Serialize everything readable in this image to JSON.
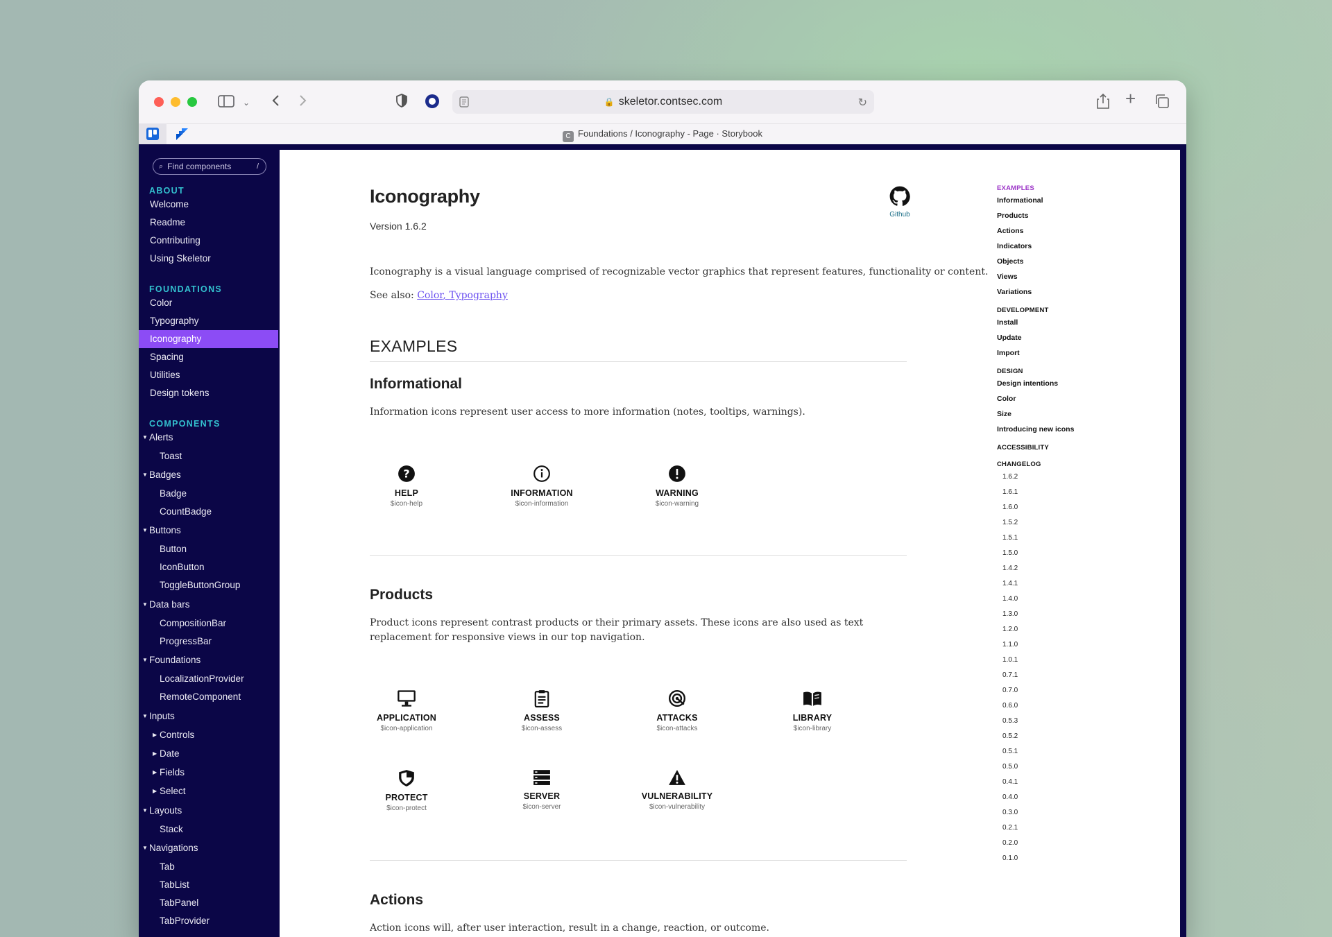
{
  "browser": {
    "url": "skeletor.contsec.com",
    "tab_title": "Foundations / Iconography - Page · Storybook",
    "favicon": "C"
  },
  "sidebar": {
    "search_placeholder": "Find components",
    "search_shortcut": "/",
    "sections": {
      "about": "ABOUT",
      "foundations": "FOUNDATIONS",
      "components": "COMPONENTS"
    },
    "about": [
      "Welcome",
      "Readme",
      "Contributing",
      "Using Skeletor"
    ],
    "foundations": [
      "Color",
      "Typography",
      "Iconography",
      "Spacing",
      "Utilities",
      "Design tokens"
    ],
    "components": {
      "alerts": "Alerts",
      "toast": "Toast",
      "badges": "Badges",
      "badge": "Badge",
      "countbadge": "CountBadge",
      "buttons": "Buttons",
      "button": "Button",
      "iconbutton": "IconButton",
      "togglebuttongroup": "ToggleButtonGroup",
      "databars": "Data bars",
      "compositionbar": "CompositionBar",
      "progressbar": "ProgressBar",
      "foundations": "Foundations",
      "localizationprovider": "LocalizationProvider",
      "remotecomponent": "RemoteComponent",
      "inputs": "Inputs",
      "controls": "Controls",
      "date": "Date",
      "fields": "Fields",
      "select": "Select",
      "layouts": "Layouts",
      "stack": "Stack",
      "navigations": "Navigations",
      "tab": "Tab",
      "tablist": "TabList",
      "tabpanel": "TabPanel",
      "tabprovider": "TabProvider"
    }
  },
  "page": {
    "title": "Iconography",
    "version": "Version 1.6.2",
    "github_label": "Github",
    "intro": "Iconography is a visual language comprised of recognizable vector graphics that represent features, functionality or content.",
    "see_also_prefix": "See also: ",
    "see_also_color": "Color",
    "see_also_sep": ", ",
    "see_also_typography": "Typography",
    "examples_heading": "EXAMPLES",
    "informational": {
      "heading": "Informational",
      "desc": "Information icons represent user access to more information (notes, tooltips, warnings).",
      "icons": [
        {
          "name": "HELP",
          "token": "$icon-help",
          "icon": "help-icon"
        },
        {
          "name": "INFORMATION",
          "token": "$icon-information",
          "icon": "information-icon"
        },
        {
          "name": "WARNING",
          "token": "$icon-warning",
          "icon": "warning-icon"
        }
      ]
    },
    "products": {
      "heading": "Products",
      "desc": "Product icons represent contrast products or their primary assets. These icons are also used as text replacement for responsive views in our top navigation.",
      "icons": [
        {
          "name": "APPLICATION",
          "token": "$icon-application",
          "icon": "monitor-icon"
        },
        {
          "name": "ASSESS",
          "token": "$icon-assess",
          "icon": "clipboard-icon"
        },
        {
          "name": "ATTACKS",
          "token": "$icon-attacks",
          "icon": "target-icon"
        },
        {
          "name": "LIBRARY",
          "token": "$icon-library",
          "icon": "book-icon"
        },
        {
          "name": "PROTECT",
          "token": "$icon-protect",
          "icon": "shield-icon"
        },
        {
          "name": "SERVER",
          "token": "$icon-server",
          "icon": "server-icon"
        },
        {
          "name": "VULNERABILITY",
          "token": "$icon-vulnerability",
          "icon": "alert-triangle-icon"
        }
      ]
    },
    "actions": {
      "heading": "Actions",
      "desc": "Action icons will, after user interaction, result in a change, reaction, or outcome."
    }
  },
  "toc": {
    "examples": "EXAMPLES",
    "examples_items": [
      "Informational",
      "Products",
      "Actions",
      "Indicators",
      "Objects",
      "Views",
      "Variations"
    ],
    "development": "DEVELOPMENT",
    "development_items": [
      "Install",
      "Update",
      "Import"
    ],
    "design": "DESIGN",
    "design_items": [
      "Design intentions",
      "Color",
      "Size",
      "Introducing new icons"
    ],
    "accessibility": "ACCESSIBILITY",
    "changelog": "CHANGELOG",
    "versions": [
      "1.6.2",
      "1.6.1",
      "1.6.0",
      "1.5.2",
      "1.5.1",
      "1.5.0",
      "1.4.2",
      "1.4.1",
      "1.4.0",
      "1.3.0",
      "1.2.0",
      "1.1.0",
      "1.0.1",
      "0.7.1",
      "0.7.0",
      "0.6.0",
      "0.5.3",
      "0.5.2",
      "0.5.1",
      "0.5.0",
      "0.4.1",
      "0.4.0",
      "0.3.0",
      "0.2.1",
      "0.2.0",
      "0.1.0"
    ]
  },
  "colors": {
    "sidebar_bg": "#0b0647",
    "active": "#8c4cf5",
    "section": "#33c1cf",
    "link": "#6a4ff0",
    "toc_active": "#9b33c7"
  }
}
